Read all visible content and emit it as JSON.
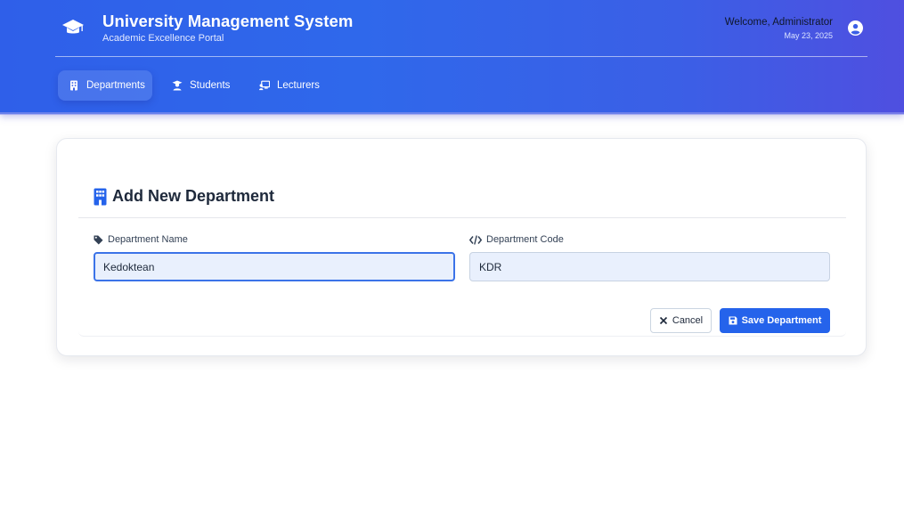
{
  "header": {
    "title": "University Management System",
    "subtitle": "Academic Excellence Portal",
    "welcome": "Welcome, Administrator",
    "date": "May 23, 2025"
  },
  "nav": {
    "items": [
      {
        "label": "Departments",
        "icon": "building-icon",
        "active": true
      },
      {
        "label": "Students",
        "icon": "graduate-icon",
        "active": false
      },
      {
        "label": "Lecturers",
        "icon": "chalkboard-teacher-icon",
        "active": false
      }
    ]
  },
  "form": {
    "title": "Add New Department",
    "name_label": "Department Name",
    "name_value": "Kedoktean",
    "code_label": "Department Code",
    "code_value": "KDR",
    "cancel_label": "Cancel",
    "save_label": "Save Department"
  },
  "colors": {
    "header_gradient_start": "#2f5fe9",
    "header_gradient_end": "#4f4fe0",
    "primary_button": "#2563eb",
    "input_background": "#e9f0fd"
  }
}
